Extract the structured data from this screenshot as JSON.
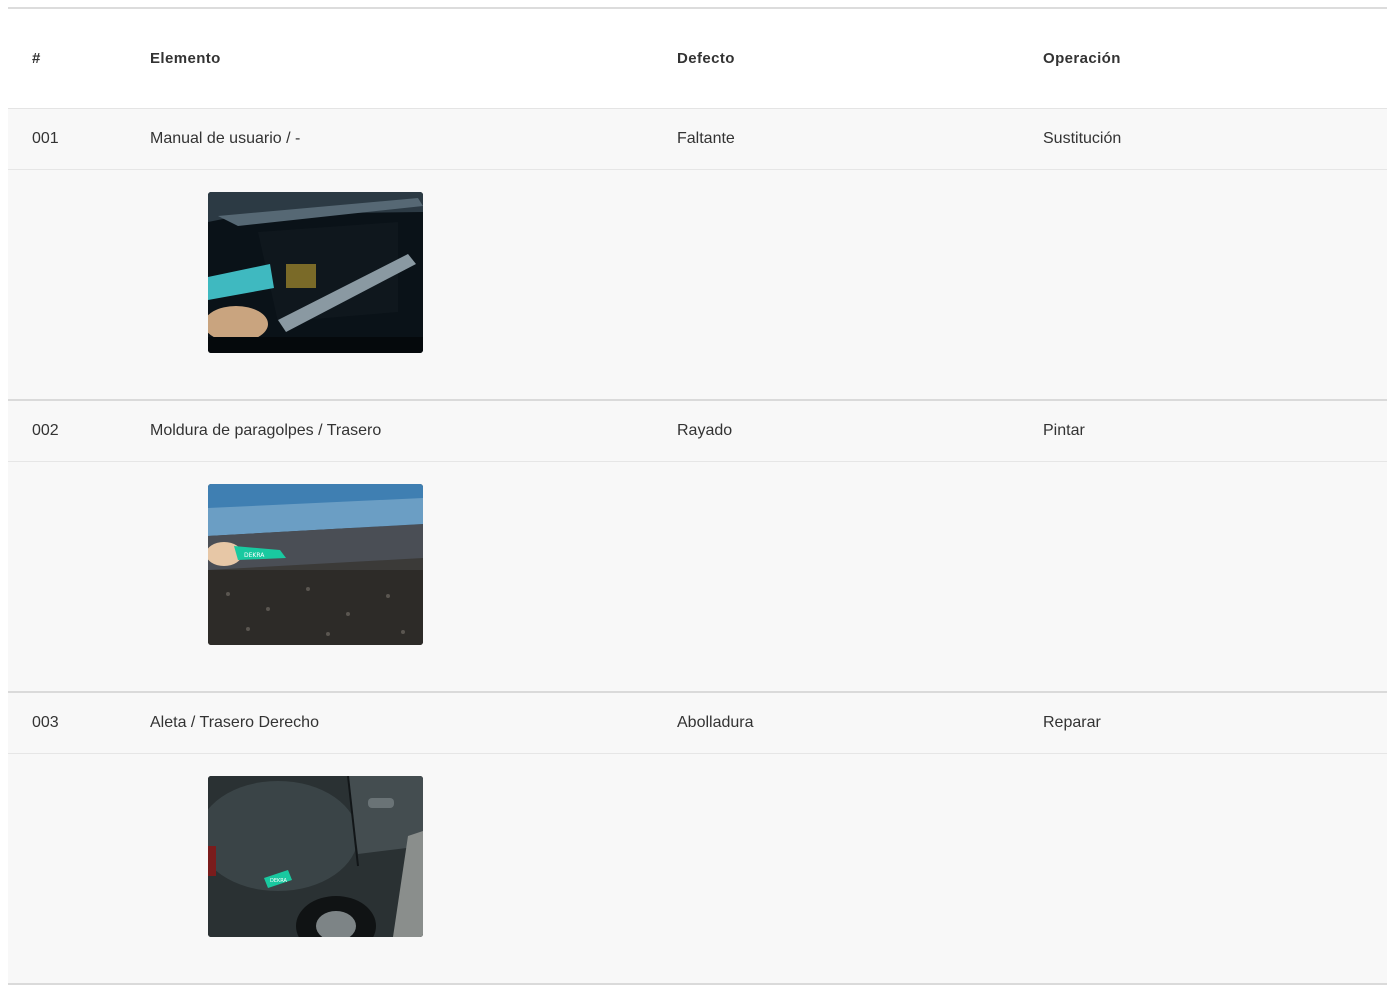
{
  "table": {
    "headers": [
      "#",
      "Elemento",
      "Defecto",
      "Operación"
    ],
    "rows": [
      {
        "num": "001",
        "elemento": "Manual de usuario / -",
        "defecto": "Faltante",
        "operacion": "Sustitución",
        "photo": "glovebox-photo"
      },
      {
        "num": "002",
        "elemento": "Moldura de paragolpes / Trasero",
        "defecto": "Rayado",
        "operacion": "Pintar",
        "photo": "bumper-photo",
        "photo_tag": "DEKRA"
      },
      {
        "num": "003",
        "elemento": "Aleta / Trasero Derecho",
        "defecto": "Abolladura",
        "operacion": "Reparar",
        "photo": "rear-fender-photo",
        "photo_tag": "DEKRA"
      }
    ]
  },
  "colors": {
    "accent_tag": "#19c9a0",
    "row_bg": "#f8f8f8",
    "divider": "#dadada"
  }
}
